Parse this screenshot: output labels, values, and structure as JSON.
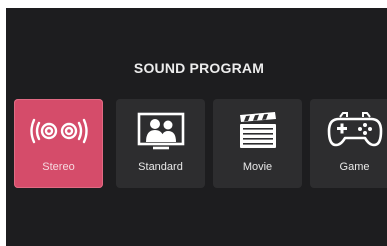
{
  "menu": {
    "title": "SOUND PROGRAM",
    "options": [
      {
        "label": "Stereo",
        "icon": "stereo-speakers-icon",
        "selected": true
      },
      {
        "label": "Standard",
        "icon": "tv-viewers-icon",
        "selected": false
      },
      {
        "label": "Movie",
        "icon": "clapperboard-icon",
        "selected": false
      },
      {
        "label": "Game",
        "icon": "gamepad-icon",
        "selected": false
      }
    ]
  },
  "colors": {
    "background": "#1d1d1f",
    "tile": "#2d2d2f",
    "selected_tile": "#d54c6a",
    "text": "#ececec"
  }
}
